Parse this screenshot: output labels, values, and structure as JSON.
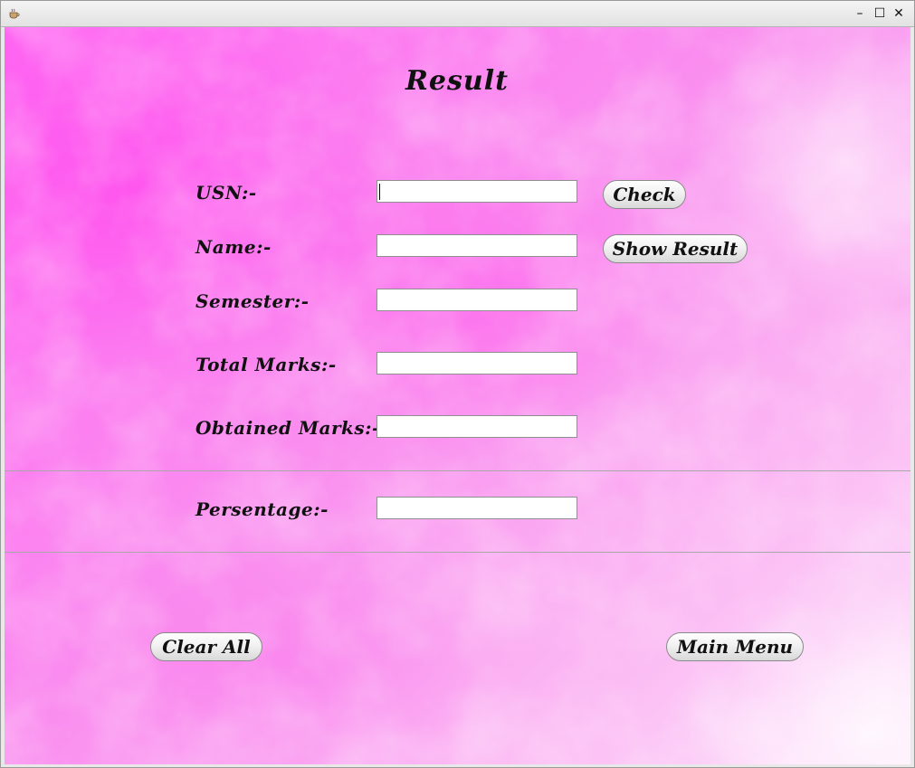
{
  "window": {
    "controls": {
      "minimize": "–",
      "maximize": "☐",
      "close": "✕"
    }
  },
  "form": {
    "title": "Result",
    "fields": [
      {
        "label": "USN:-",
        "value": "",
        "placeholder": ""
      },
      {
        "label": "Name:-",
        "value": "",
        "placeholder": ""
      },
      {
        "label": "Semester:-",
        "value": "",
        "placeholder": ""
      },
      {
        "label": "Total Marks:-",
        "value": "",
        "placeholder": ""
      },
      {
        "label": "Obtained Marks:-",
        "value": "",
        "placeholder": ""
      },
      {
        "label": "Persentage:-",
        "value": "",
        "placeholder": ""
      }
    ]
  },
  "buttons": {
    "check": "Check",
    "show_result": "Show Result",
    "clear_all": "Clear All",
    "main_menu": "Main Menu"
  },
  "icons": {
    "app": "java-cup-icon"
  },
  "colors": {
    "background_primary": "#ff66f2",
    "background_light": "#fde2fb",
    "text": "#111111",
    "divider": "#a8a8a8"
  }
}
